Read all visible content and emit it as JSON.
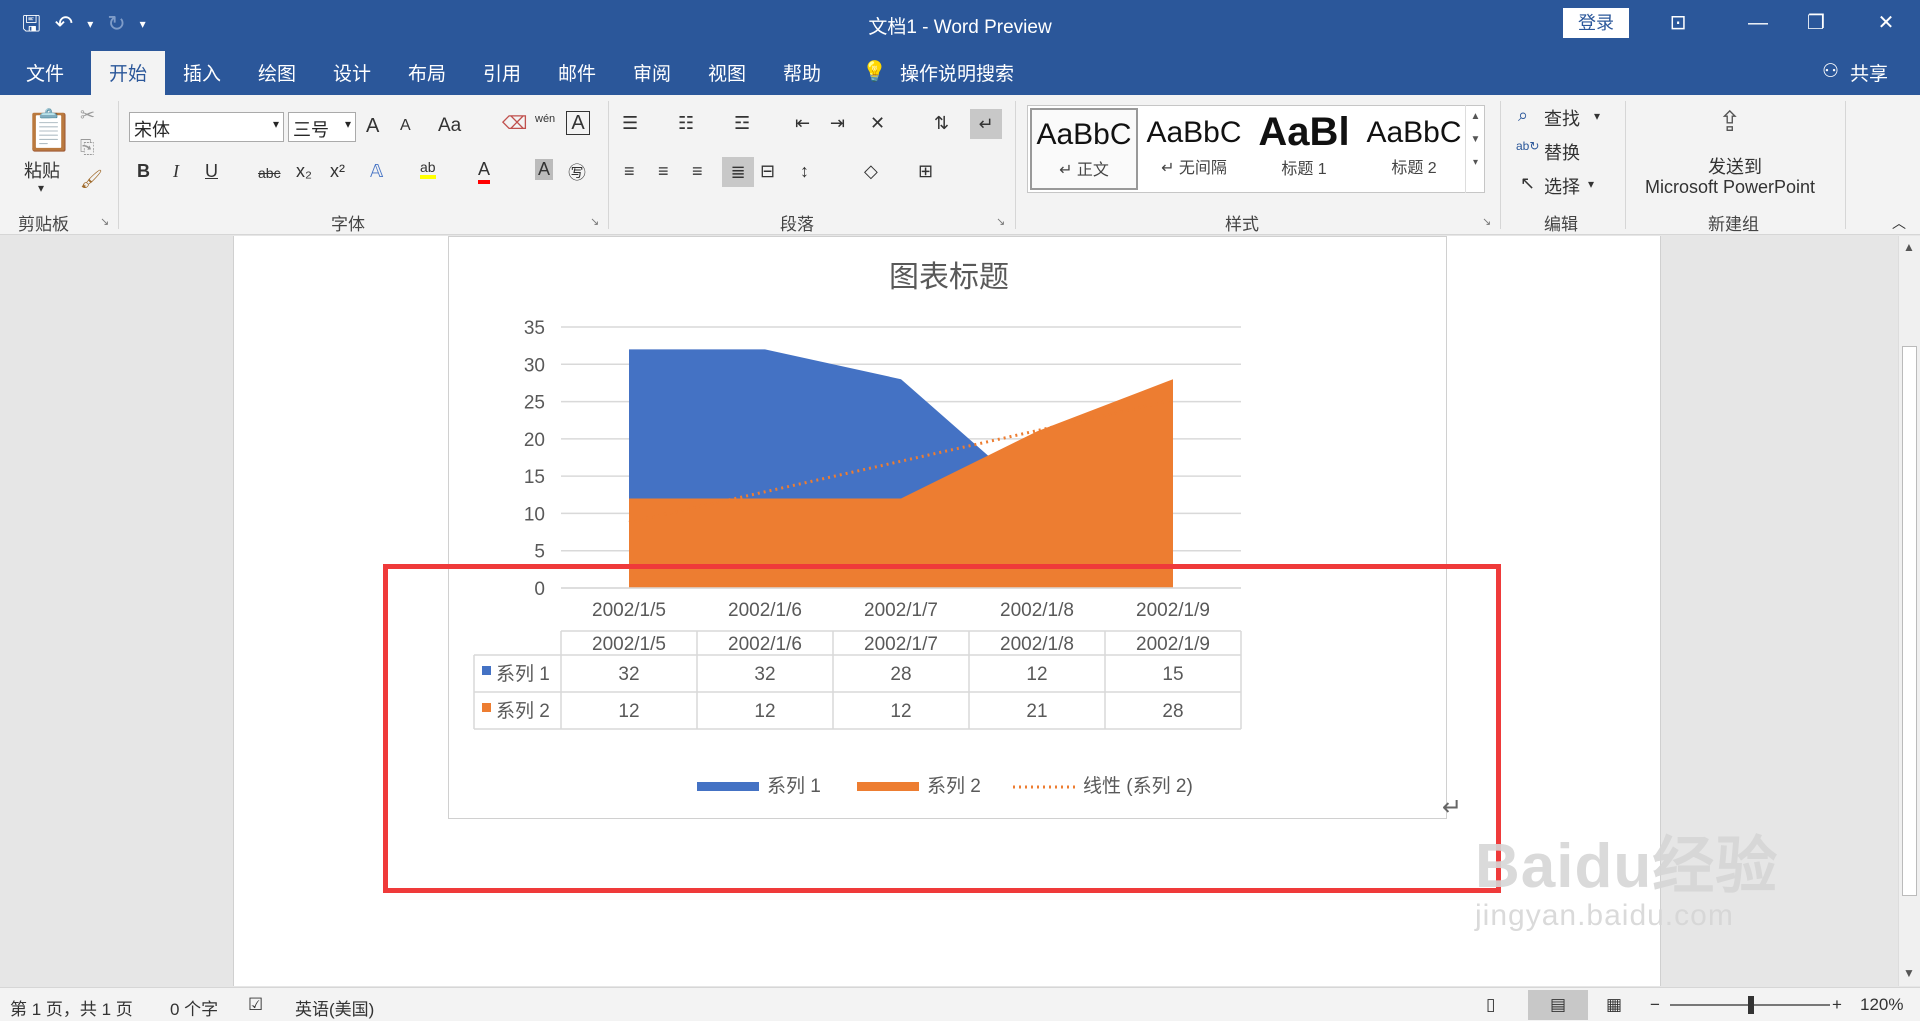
{
  "app": {
    "title": "文档1 - Word Preview",
    "login_label": "登录",
    "share_label": "共享",
    "tell_me": "操作说明搜索"
  },
  "tabs": [
    "文件",
    "开始",
    "插入",
    "绘图",
    "设计",
    "布局",
    "引用",
    "邮件",
    "审阅",
    "视图",
    "帮助"
  ],
  "ribbon": {
    "paste_label": "粘贴",
    "font_name": "宋体",
    "font_size": "三号",
    "grow_font": "A",
    "shrink_font": "A",
    "change_case": "Aa",
    "pinyin": "wén",
    "bold": "B",
    "italic": "I",
    "underline": "U",
    "strike": "abc",
    "sub": "x₂",
    "sup": "x²",
    "highlight": "ab",
    "font_color": "A",
    "shading": "A",
    "styles": [
      {
        "sample": "AaBbC",
        "name": "↵ 正文"
      },
      {
        "sample": "AaBbC",
        "name": "↵ 无间隔"
      },
      {
        "sample": "AaBl",
        "name": "标题 1"
      },
      {
        "sample": "AaBbC",
        "name": "标题 2"
      }
    ],
    "find_label": "查找",
    "replace_label": "替换",
    "select_label": "选择",
    "send_to": "发送到",
    "send_to_app": "Microsoft PowerPoint",
    "groups": {
      "clipboard": "剪贴板",
      "font": "字体",
      "paragraph": "段落",
      "styles": "样式",
      "editing": "编辑",
      "new_group": "新建组"
    }
  },
  "status": {
    "page": "第 1 页，共 1 页",
    "words": "0 个字",
    "language": "英语(美国)",
    "zoom": "120%"
  },
  "watermark": {
    "logo_text": "Baidu经验",
    "url": "jingyan.baidu.com"
  },
  "chart_data": {
    "type": "area",
    "title": "图表标题",
    "categories": [
      "2002/1/5",
      "2002/1/6",
      "2002/1/7",
      "2002/1/8",
      "2002/1/9"
    ],
    "series": [
      {
        "name": "系列 1",
        "values": [
          32,
          32,
          28,
          12,
          15
        ],
        "color": "#4472c4"
      },
      {
        "name": "系列 2",
        "values": [
          12,
          12,
          12,
          21,
          28
        ],
        "color": "#ed7d31"
      }
    ],
    "trendline": {
      "name": "线性 (系列 2)",
      "of_series": "系列 2",
      "type": "linear",
      "style": "dotted",
      "color": "#ed7d31"
    },
    "ylim": [
      0,
      35
    ],
    "yticks": [
      0,
      5,
      10,
      15,
      20,
      25,
      30,
      35
    ],
    "grid": true,
    "data_table": true,
    "legend": "bottom"
  }
}
